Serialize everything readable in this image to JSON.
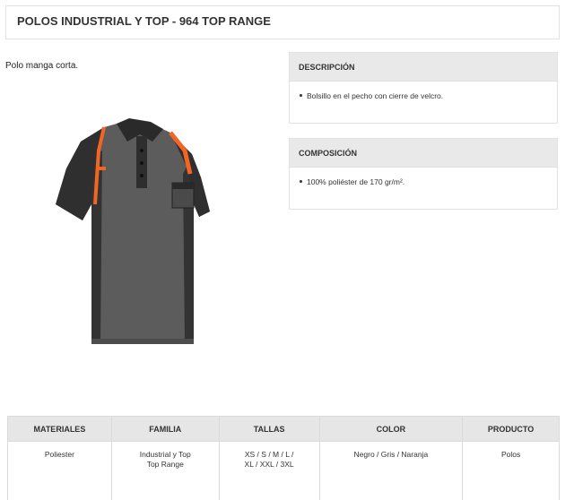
{
  "page": {
    "title": "POLOS INDUSTRIAL Y TOP - 964 TOP RANGE",
    "subtitle": "Polo manga corta."
  },
  "product_image": {
    "icon": "polo-shirt-image",
    "colors": {
      "body": "#5f5f5f",
      "dark": "#2e2e2e",
      "accent": "#f26522"
    }
  },
  "description": {
    "heading": "DESCRIPCIÓN",
    "items": [
      "Bolsillo en el pecho con cierre de velcro."
    ]
  },
  "composition": {
    "heading": "COMPOSICIÓN",
    "items": [
      "100% poliéster de 170 gr/m²."
    ]
  },
  "specs": {
    "headers": [
      "MATERIALES",
      "FAMILIA",
      "TALLAS",
      "COLOR",
      "PRODUCTO"
    ],
    "values": [
      "Poliester",
      "Industrial y Top Top Range",
      "XS / S / M / L / XL / XXL / 3XL",
      "Negro / Gris / Naranja",
      "Polos"
    ]
  }
}
